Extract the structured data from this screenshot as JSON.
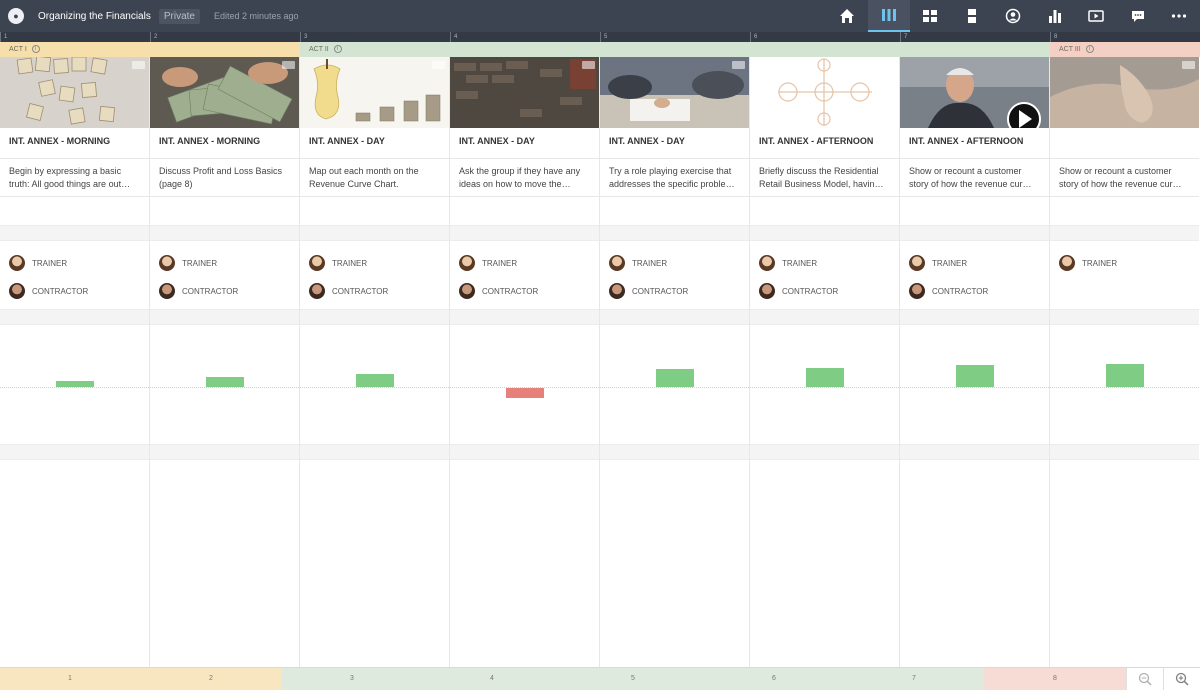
{
  "header": {
    "title": "Organizing the Financials",
    "privacy": "Private",
    "edited": "Edited 2 minutes ago",
    "icons": [
      "home-icon",
      "columns-view-icon",
      "grid-view-icon",
      "rows-view-icon",
      "characters-icon",
      "stats-icon",
      "media-icon",
      "comments-icon",
      "more-icon"
    ],
    "active_icon": "columns-view-icon"
  },
  "ruler": [
    "1",
    "2",
    "3",
    "4",
    "5",
    "6",
    "7",
    "8"
  ],
  "acts": [
    {
      "label": "ACT I",
      "color": "#f6dfaa"
    },
    {
      "label": "ACT II",
      "color": "#d3e4d2"
    },
    {
      "label": "ACT III",
      "color": "#f4cfc4"
    }
  ],
  "scenes": [
    {
      "heading": "INT. ANNEX - MORNING",
      "description": "Begin by expressing a basic truth: All good things are out…",
      "characters": [
        "TRAINER",
        "CONTRACTOR"
      ],
      "value": 0.3
    },
    {
      "heading": "INT. ANNEX - MORNING",
      "description": "Discuss Profit and Loss Basics (page 8)",
      "characters": [
        "TRAINER",
        "CONTRACTOR"
      ],
      "value": 0.5
    },
    {
      "heading": "INT. ANNEX - DAY",
      "description": "Map out each month on the Revenue Curve Chart.",
      "characters": [
        "TRAINER",
        "CONTRACTOR"
      ],
      "value": 0.65
    },
    {
      "heading": "INT. ANNEX - DAY",
      "description": "Ask the group if they have any ideas on how to move the…",
      "characters": [
        "TRAINER",
        "CONTRACTOR"
      ],
      "value": -0.5
    },
    {
      "heading": "INT. ANNEX - DAY",
      "description": "Try a role playing exercise that addresses the specific proble…",
      "characters": [
        "TRAINER",
        "CONTRACTOR"
      ],
      "value": 0.9
    },
    {
      "heading": "INT. ANNEX - AFTERNOON",
      "description": "Briefly discuss the Residential Retail Business Model, havin…",
      "characters": [
        "TRAINER",
        "CONTRACTOR"
      ],
      "value": 0.95
    },
    {
      "heading": "INT. ANNEX - AFTERNOON",
      "description": "Show or recount a customer story of how the revenue cur…",
      "characters": [
        "TRAINER",
        "CONTRACTOR"
      ],
      "value": 1.1
    },
    {
      "heading": "",
      "description": "Show or recount a customer story of how the revenue cur…",
      "characters": [
        "TRAINER"
      ],
      "value": 1.15
    }
  ],
  "thumbnails": [
    "scrabble-tiles-image",
    "money-hands-image",
    "apple-coins-image",
    "brick-wall-image",
    "meeting-hands-image",
    "diagram-sketch-image",
    "interview-man-video",
    "feet-image"
  ],
  "colors": {
    "positive": "#7fcc85",
    "negative": "#e5807a",
    "accent": "#6cc3ec"
  },
  "bottom": {
    "numbers": [
      "1",
      "2",
      "3",
      "4",
      "5",
      "6",
      "7",
      "8"
    ],
    "zoom_icons": [
      "zoom-out-icon",
      "zoom-in-icon"
    ]
  }
}
